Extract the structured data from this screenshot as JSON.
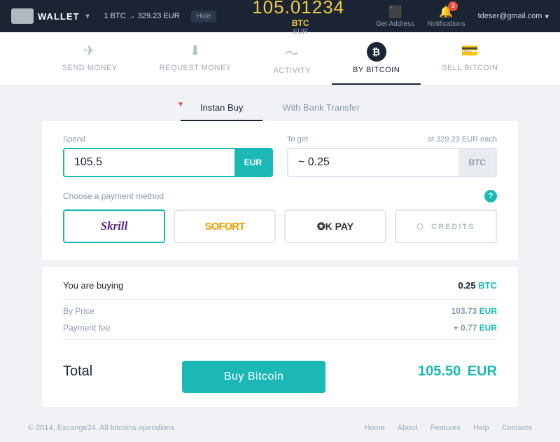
{
  "topnav": {
    "wallet_label": "WALLET",
    "exchange_rate": "1 BTC → 329.23 EUR",
    "hide_label": "Hide",
    "balance_amount": "105.01234",
    "balance_btc": "BTC",
    "balance_eur": "EUR",
    "get_address_label": "Get Address",
    "notifications_label": "Notifications",
    "notifications_badge": "3",
    "user_email": "tdeser@gmail.com"
  },
  "tabs": [
    {
      "id": "send-money",
      "label": "SEND MONEY",
      "icon": "✈"
    },
    {
      "id": "request-money",
      "label": "REQUEST MONEY",
      "icon": "↓"
    },
    {
      "id": "activity",
      "label": "ACTIVITY",
      "icon": "⚡"
    },
    {
      "id": "by-bitcoin",
      "label": "BY BITCOIN",
      "icon": "₿",
      "active": true
    },
    {
      "id": "sell-bitcoin",
      "label": "SELL BITCOIN",
      "icon": "💳"
    }
  ],
  "sub_tabs": [
    {
      "id": "instan-buy",
      "label": "Instan Buy",
      "active": true
    },
    {
      "id": "bank-transfer",
      "label": "With Bank Transfer",
      "active": false
    }
  ],
  "form": {
    "spend_label": "Spend",
    "spend_value": "105.5",
    "spend_unit": "EUR",
    "to_get_label": "To get",
    "to_get_value": "~ 0.25",
    "to_get_unit": "BTC",
    "rate_label": "at 329.23 EUR each",
    "payment_label": "Choose a payment method",
    "payment_methods": [
      {
        "id": "skrill",
        "label": "Skrill",
        "active": true
      },
      {
        "id": "sofort",
        "label": "SOFORT",
        "active": false
      },
      {
        "id": "okpay",
        "label": "✪K PAY",
        "active": false
      },
      {
        "id": "credits",
        "label": "CREDITS",
        "active": false
      }
    ]
  },
  "summary": {
    "buying_label": "You are buying",
    "buying_value": "0.25",
    "buying_unit": "BTC",
    "price_label": "By Price",
    "price_value": "103.73",
    "price_unit": "EUR",
    "fee_label": "Payment fee",
    "fee_value": "+ 0.77",
    "fee_unit": "EUR",
    "total_label": "Total",
    "total_value": "105.50",
    "total_unit": "EUR"
  },
  "buy_button_label": "Buy Bitcoin",
  "footer": {
    "copyright": "© 2014, Excange24. All bitcoins operations",
    "links": [
      "Home",
      "About",
      "Features",
      "Help",
      "Contacts"
    ]
  }
}
